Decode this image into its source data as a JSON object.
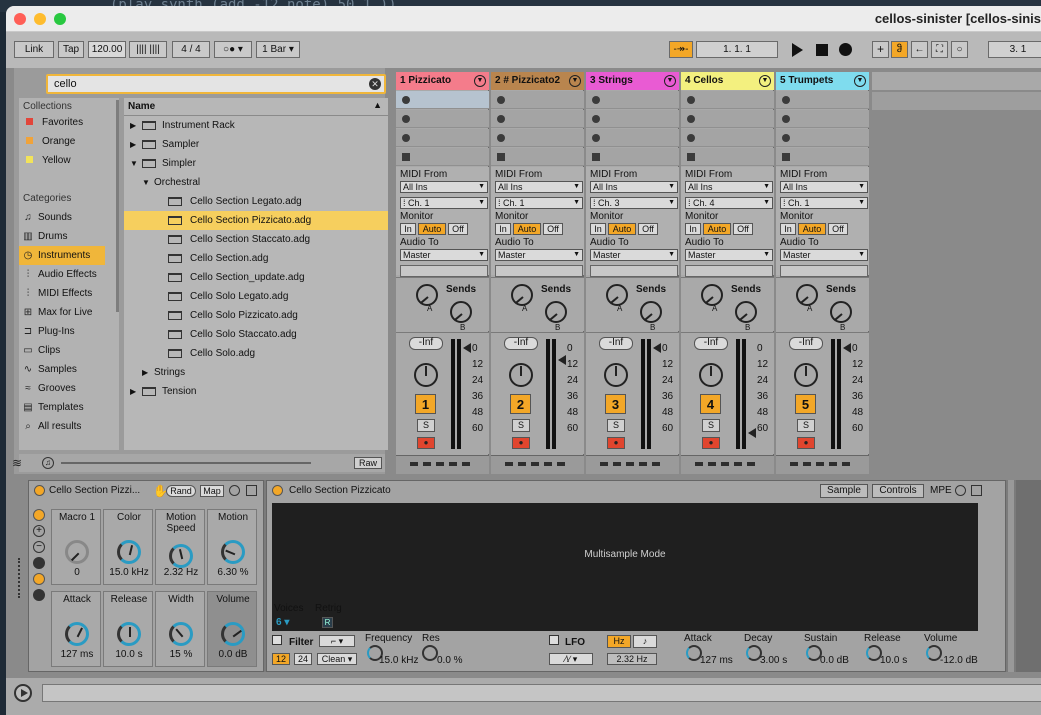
{
  "code_bg": "(play synth (add -12 note) 50 1 ))",
  "window": {
    "title": "cellos-sinister  [cellos-sinis"
  },
  "transport": {
    "link": "Link",
    "tap": "Tap",
    "tempo": "120.00",
    "nudge": "|||| ||||",
    "signature": "4 / 4",
    "metro": "○● ▾",
    "quantize": "1 Bar ▾",
    "follow": "-↠-",
    "position": "1.   1.   1",
    "loop_pos": "3.   1"
  },
  "browser": {
    "search_value": "cello",
    "collections_title": "Collections",
    "collections": [
      {
        "label": "Favorites",
        "color": "#e2453a"
      },
      {
        "label": "Orange",
        "color": "#f0a33a"
      },
      {
        "label": "Yellow",
        "color": "#f2e35a"
      }
    ],
    "categories_title": "Categories",
    "categories": [
      {
        "label": "Sounds",
        "icon": "sounds-icon",
        "glyph": "♫"
      },
      {
        "label": "Drums",
        "icon": "drums-icon",
        "glyph": "▥"
      },
      {
        "label": "Instruments",
        "icon": "instruments-icon",
        "glyph": "◷"
      },
      {
        "label": "Audio Effects",
        "icon": "audio-effects-icon",
        "glyph": "⫶"
      },
      {
        "label": "MIDI Effects",
        "icon": "midi-effects-icon",
        "glyph": "⫶"
      },
      {
        "label": "Max for Live",
        "icon": "max-for-live-icon",
        "glyph": "⊞"
      },
      {
        "label": "Plug-Ins",
        "icon": "plug-ins-icon",
        "glyph": "⊐"
      },
      {
        "label": "Clips",
        "icon": "clips-icon",
        "glyph": "▭"
      },
      {
        "label": "Samples",
        "icon": "samples-icon",
        "glyph": "∿"
      },
      {
        "label": "Grooves",
        "icon": "grooves-icon",
        "glyph": "≈"
      },
      {
        "label": "Templates",
        "icon": "templates-icon",
        "glyph": "▤"
      },
      {
        "label": "All results",
        "icon": "all-results-icon",
        "glyph": "⌕"
      }
    ],
    "name_header": "Name",
    "tree": [
      {
        "label": "Instrument Rack",
        "level": 0,
        "arrow": "▶",
        "type": "folder"
      },
      {
        "label": "Sampler",
        "level": 0,
        "arrow": "▶",
        "type": "folder"
      },
      {
        "label": "Simpler",
        "level": 0,
        "arrow": "▼",
        "type": "folder"
      },
      {
        "label": "Orchestral",
        "level": 1,
        "arrow": "▼",
        "type": "none"
      },
      {
        "label": "Cello Section Legato.adg",
        "level": 2,
        "arrow": "",
        "type": "file"
      },
      {
        "label": "Cello Section Pizzicato.adg",
        "level": 2,
        "arrow": "",
        "type": "file",
        "selected": true
      },
      {
        "label": "Cello Section Staccato.adg",
        "level": 2,
        "arrow": "",
        "type": "file"
      },
      {
        "label": "Cello Section.adg",
        "level": 2,
        "arrow": "",
        "type": "file"
      },
      {
        "label": "Cello Section_update.adg",
        "level": 2,
        "arrow": "",
        "type": "file"
      },
      {
        "label": "Cello Solo Legato.adg",
        "level": 2,
        "arrow": "",
        "type": "file"
      },
      {
        "label": "Cello Solo Pizzicato.adg",
        "level": 2,
        "arrow": "",
        "type": "file"
      },
      {
        "label": "Cello Solo Staccato.adg",
        "level": 2,
        "arrow": "",
        "type": "file"
      },
      {
        "label": "Cello Solo.adg",
        "level": 2,
        "arrow": "",
        "type": "file"
      },
      {
        "label": "Strings",
        "level": 1,
        "arrow": "▶",
        "type": "none"
      },
      {
        "label": "Tension",
        "level": 0,
        "arrow": "▶",
        "type": "folder"
      }
    ],
    "raw": "Raw"
  },
  "mixer": {
    "labels": {
      "midi_from": "MIDI From",
      "monitor": "Monitor",
      "audio_to": "Audio To",
      "sends": "Sends",
      "in": "In",
      "auto": "Auto",
      "off": "Off",
      "inf": "-Inf",
      "solo": "S",
      "send_a": "A",
      "send_b": "B"
    },
    "scale": [
      "0",
      "12",
      "24",
      "36",
      "48",
      "60"
    ],
    "tracks": [
      {
        "name": "1 Pizzicato",
        "color": "#f47c8b",
        "from": "All Ins",
        "channel": "⁞ Ch. 1",
        "to": "Master",
        "num": "1"
      },
      {
        "name": "2 # Pizzicato2",
        "color": "#b9854e",
        "from": "All Ins",
        "channel": "⁞ Ch. 1",
        "to": "Master",
        "num": "2"
      },
      {
        "name": "3 Strings",
        "color": "#e95bd3",
        "from": "All Ins",
        "channel": "⁞ Ch. 3",
        "to": "Master",
        "num": "3"
      },
      {
        "name": "4 Cellos",
        "color": "#f3f07f",
        "from": "All Ins",
        "channel": "⁞ Ch. 4",
        "to": "Master",
        "num": "4"
      },
      {
        "name": "5 Trumpets",
        "color": "#7fdcee",
        "from": "All Ins",
        "channel": "⁞ Ch. 1",
        "to": "Master",
        "num": "5"
      }
    ]
  },
  "rack": {
    "title": "Cello Section Pizzi...",
    "rand": "Rand",
    "map": "Map",
    "macros": [
      {
        "name": "Macro 1",
        "value": "0",
        "level": 0.0
      },
      {
        "name": "Color",
        "value": "15.0 kHz",
        "level": 0.55
      },
      {
        "name": "Motion Speed",
        "value": "2.32 Hz",
        "level": 0.45
      },
      {
        "name": "Motion",
        "value": "6.30 %",
        "level": 0.25
      },
      {
        "name": "Attack",
        "value": "127 ms",
        "level": 0.6
      },
      {
        "name": "Release",
        "value": "10.0 s",
        "level": 0.5
      },
      {
        "name": "Width",
        "value": "15 %",
        "level": 0.35
      },
      {
        "name": "Volume",
        "value": "0.0 dB",
        "level": 0.7
      }
    ]
  },
  "simpler": {
    "title": "Cello Section Pizzicato",
    "tab_sample": "Sample",
    "tab_controls": "Controls",
    "mpe": "MPE",
    "mode": "Multisample Mode",
    "voices_label": "Voices",
    "voices_value": "6 ▾",
    "retrig_label": "Retrig",
    "retrig_value": "R",
    "filter_label": "Filter",
    "filter_12": "12",
    "filter_24": "24",
    "filter_clean": "Clean ▾",
    "freq_label": "Frequency",
    "freq_value": "15.0 kHz",
    "res_label": "Res",
    "res_value": "0.0 %",
    "lfo_label": "LFO",
    "lfo_hz": "Hz",
    "lfo_note": "♪",
    "lfo_wave": "∕\\∕ ▾",
    "lfo_rate": "2.32 Hz",
    "env": [
      {
        "label": "Attack",
        "value": "127 ms"
      },
      {
        "label": "Decay",
        "value": "3.00 s"
      },
      {
        "label": "Sustain",
        "value": "0.0 dB"
      },
      {
        "label": "Release",
        "value": "10.0 s"
      },
      {
        "label": "Volume",
        "value": "-12.0 dB"
      }
    ]
  },
  "colors": {
    "accent": "#f0a33a",
    "selected_row": "#f6cf5e"
  }
}
